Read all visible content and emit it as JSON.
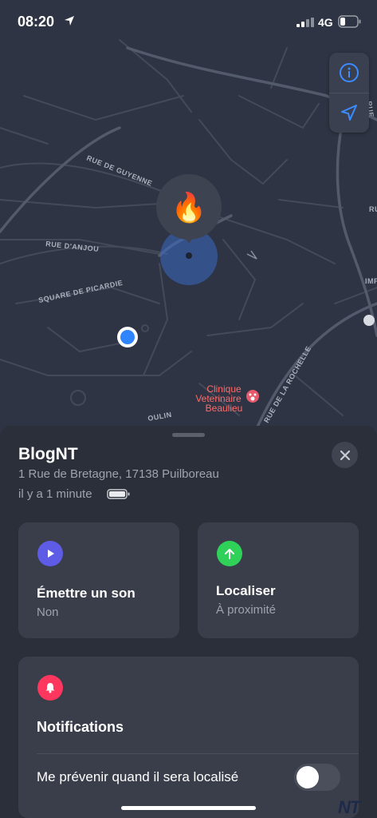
{
  "status_bar": {
    "time": "08:20",
    "network": "4G"
  },
  "map": {
    "streets": [
      "RUE DE GUYENNE",
      "RUE D'ANJOU",
      "SQUARE DE PICARDIE",
      "RUE DE LA ROCHELLE",
      "OULIN",
      "RUE",
      "RUE",
      "IMP"
    ],
    "poi": {
      "line1": "Clinique",
      "line2": "Veterinaire",
      "line3": "Beaulieu"
    },
    "pin_emoji": "🔥",
    "controls": {
      "info_icon": "info-icon",
      "locate_icon": "location-arrow-icon"
    }
  },
  "sheet": {
    "device_name": "BlogNT",
    "address": "1 Rue de Bretagne, 17138 Puilboreau",
    "updated": "il y a 1 minute",
    "actions": [
      {
        "label": "Émettre un son",
        "sub": "Non",
        "color": "#5e5ce6",
        "icon": "play-icon"
      },
      {
        "label": "Localiser",
        "sub": "À proximité",
        "color": "#30d158",
        "icon": "arrow-up-icon"
      }
    ],
    "notifications": {
      "title": "Notifications",
      "color": "#ff375f",
      "icon": "bell-icon",
      "notify_label": "Me prévenir quand il sera localisé",
      "notify_enabled": false
    }
  },
  "watermark": "NT"
}
